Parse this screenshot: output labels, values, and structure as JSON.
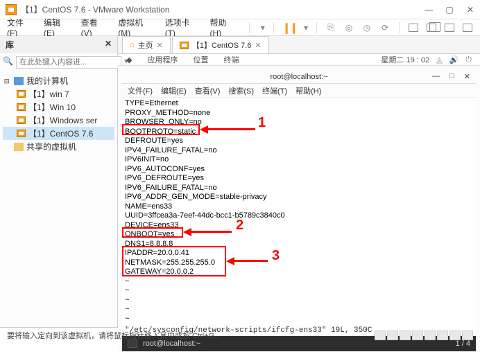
{
  "window": {
    "title": "【1】CentOS 7.6 - VMware Workstation"
  },
  "menubar": {
    "file": "文件(F)",
    "edit": "编辑(E)",
    "view": "查看(V)",
    "vm": "虚拟机(M)",
    "tabs": "选项卡(T)",
    "help": "帮助(H)"
  },
  "sidebar": {
    "title": "库",
    "search_placeholder": "在此处键入内容进...",
    "root": "我的计算机",
    "items": [
      {
        "label": "【1】win 7"
      },
      {
        "label": "【1】Win 10"
      },
      {
        "label": "【1】Windows ser"
      },
      {
        "label": "【1】CentOS 7.6"
      }
    ],
    "shared": "共享的虚拟机"
  },
  "tabs": {
    "home": "主页",
    "active": "【1】CentOS 7.6"
  },
  "subbar": {
    "apps": "应用程序",
    "places": "位置",
    "terminal": "终端",
    "date": "星期二 19 : 02"
  },
  "terminal": {
    "title": "root@localhost:~",
    "menu": {
      "file": "文件(F)",
      "edit": "编辑(E)",
      "view": "查看(V)",
      "search": "搜索(S)",
      "terminal": "终端(T)",
      "help": "帮助(H)"
    },
    "lines": [
      "TYPE=Ethernet",
      "PROXY_METHOD=none",
      "BROWSER_ONLY=no",
      "BOOTPROTO=static",
      "DEFROUTE=yes",
      "IPV4_FAILURE_FATAL=no",
      "IPV6INIT=no",
      "IPV6_AUTOCONF=yes",
      "IPV6_DEFROUTE=yes",
      "IPV6_FAILURE_FATAL=no",
      "IPV6_ADDR_GEN_MODE=stable-privacy",
      "NAME=ens33",
      "UUID=3ffcea3a-7eef-44dc-bcc1-b5789c3840c0",
      "DEVICE=ens33",
      "ONBOOT=yes",
      "DNS1=8.8.8.8",
      "IPADDR=20.0.0.41",
      "NETMASK=255.255.255.0",
      "GATEWAY=20.0.0.2",
      "~",
      "~",
      "~",
      "~",
      "~"
    ],
    "status": "\"/etc/sysconfig/network-scripts/ifcfg-ens33\" 19L, 350C",
    "foot_tab": "root@localhost:~",
    "foot_right": "1 / 4"
  },
  "statusbar": {
    "text": "要将输入定向到该虚拟机，请将鼠标指针移入其中或按 Ctrl+G。"
  },
  "annotations": {
    "n1": "1",
    "n2": "2",
    "n3": "3"
  },
  "chart_data": null
}
